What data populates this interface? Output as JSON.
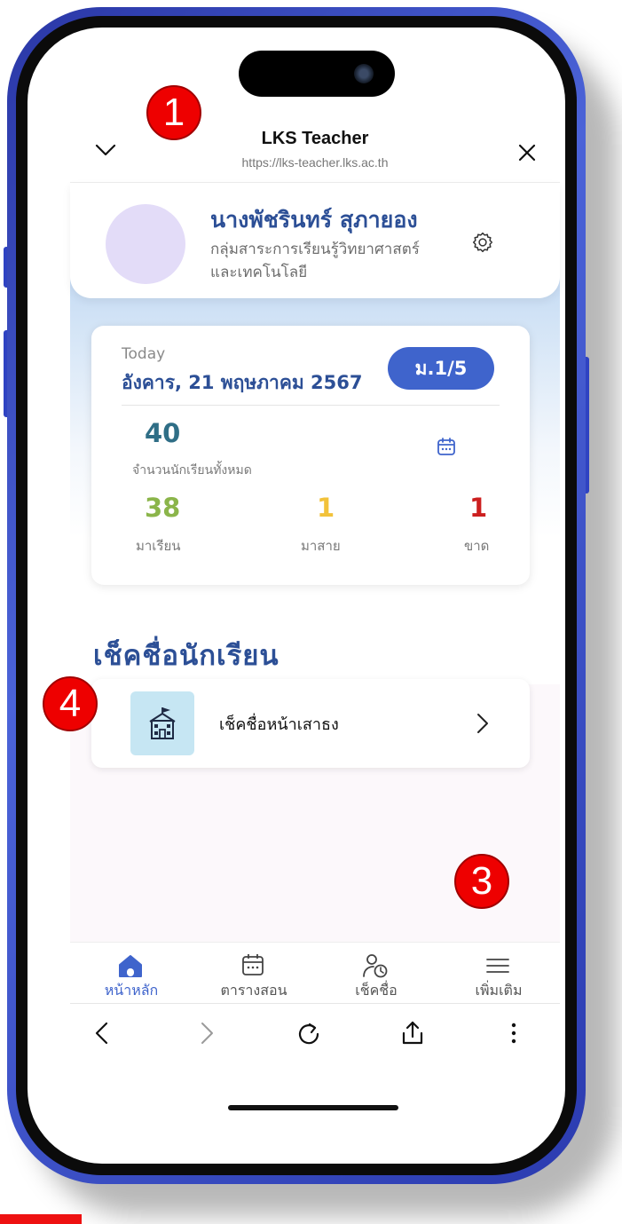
{
  "browser": {
    "title": "LKS Teacher",
    "url": "https://lks-teacher.lks.ac.th"
  },
  "profile": {
    "name": "นางพัชรินทร์ สุภายอง",
    "department": "กลุ่มสาระการเรียนรู้วิทยาศาสตร์และเทคโนโลยี"
  },
  "today_card": {
    "today_label": "Today",
    "date": "อังคาร, 21 พฤษภาคม 2567",
    "class_button": "ม.1/5",
    "total_students": "40",
    "total_label": "จำนวนนักเรียนทั้งหมด",
    "stats": [
      {
        "value": "38",
        "label": "มาเรียน",
        "color": "#8bb54a"
      },
      {
        "value": "1",
        "label": "มาสาย",
        "color": "#f2c23a"
      },
      {
        "value": "1",
        "label": "ขาด",
        "color": "#cc1f1f"
      }
    ]
  },
  "section": {
    "title": "เช็คชื่อนักเรียน",
    "item_label": "เช็คชื่อหน้าเสาธง"
  },
  "bottom_nav": {
    "items": [
      {
        "label": "หน้าหลัก",
        "icon": "home-icon",
        "active": true
      },
      {
        "label": "ตารางสอน",
        "icon": "calendar-icon",
        "active": false
      },
      {
        "label": "เช็คชื่อ",
        "icon": "user-clock-icon",
        "active": false
      },
      {
        "label": "เพิ่มเติม",
        "icon": "menu-icon",
        "active": false
      }
    ]
  },
  "annotations": {
    "badges": [
      "1",
      "3",
      "4"
    ]
  },
  "colors": {
    "accent": "#3f64cc",
    "heading": "#2c4f96",
    "badge": "#ee0000",
    "phone_frame": "#3a4fc4"
  }
}
